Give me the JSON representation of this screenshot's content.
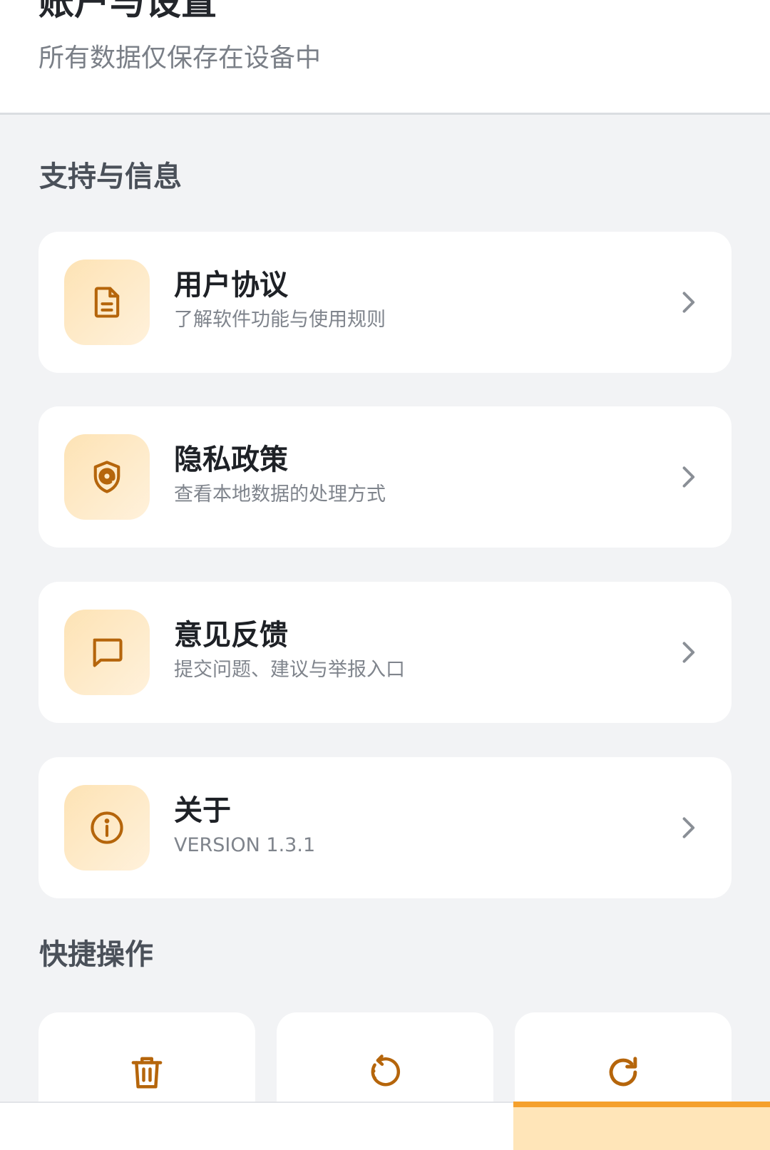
{
  "header": {
    "title": "账户与设置",
    "subtitle": "所有数据仅保存在设备中"
  },
  "sections": {
    "support": {
      "title": "支持与信息",
      "items": [
        {
          "title": "用户协议",
          "subtitle": "了解软件功能与使用规则",
          "icon": "document-icon"
        },
        {
          "title": "隐私政策",
          "subtitle": "查看本地数据的处理方式",
          "icon": "shield-icon"
        },
        {
          "title": "意见反馈",
          "subtitle": "提交问题、建议与举报入口",
          "icon": "chat-bubble-icon"
        },
        {
          "title": "关于",
          "subtitle": "VERSION 1.3.1",
          "icon": "info-icon"
        }
      ]
    },
    "quick": {
      "title": "快捷操作",
      "items": [
        {
          "icon": "trash-icon"
        },
        {
          "icon": "rotate-ccw-icon"
        },
        {
          "icon": "refresh-icon"
        }
      ]
    }
  },
  "colors": {
    "accent": "#F5A02C",
    "icon_stroke": "#B5650B",
    "icon_bg": "#FDE3B5",
    "background": "#F2F3F5"
  }
}
